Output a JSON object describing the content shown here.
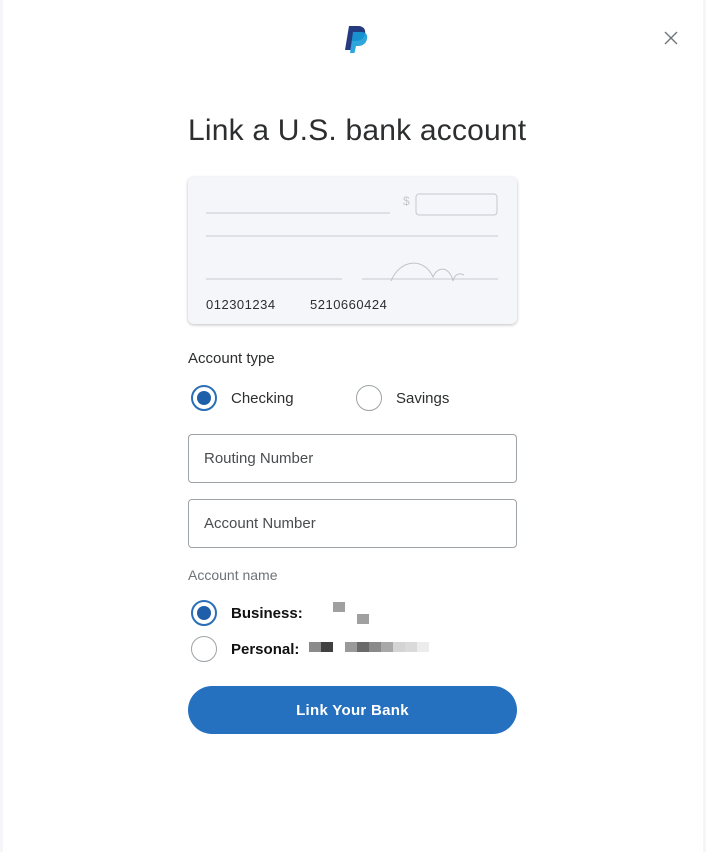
{
  "header": {
    "logo": "paypal-logo",
    "close_icon": "close-icon"
  },
  "title": "Link a U.S. bank account",
  "check_illustration": {
    "currency_symbol": "$",
    "routing_example": "012301234",
    "account_example": "5210660424"
  },
  "account_type": {
    "label": "Account type",
    "options": [
      {
        "label": "Checking",
        "selected": true
      },
      {
        "label": "Savings",
        "selected": false
      }
    ]
  },
  "fields": {
    "routing": {
      "placeholder": "Routing Number",
      "value": ""
    },
    "account": {
      "placeholder": "Account Number",
      "value": ""
    }
  },
  "account_name": {
    "label": "Account name",
    "options": [
      {
        "label": "Business:",
        "selected": true,
        "value": "[redacted]"
      },
      {
        "label": "Personal:",
        "selected": false,
        "value": "[redacted]"
      }
    ]
  },
  "submit": {
    "label": "Link Your Bank"
  },
  "colors": {
    "primary": "#2671bf",
    "radio_selected": "#1f5ea8",
    "logo_dark": "#253b80",
    "logo_light": "#179bd7"
  }
}
